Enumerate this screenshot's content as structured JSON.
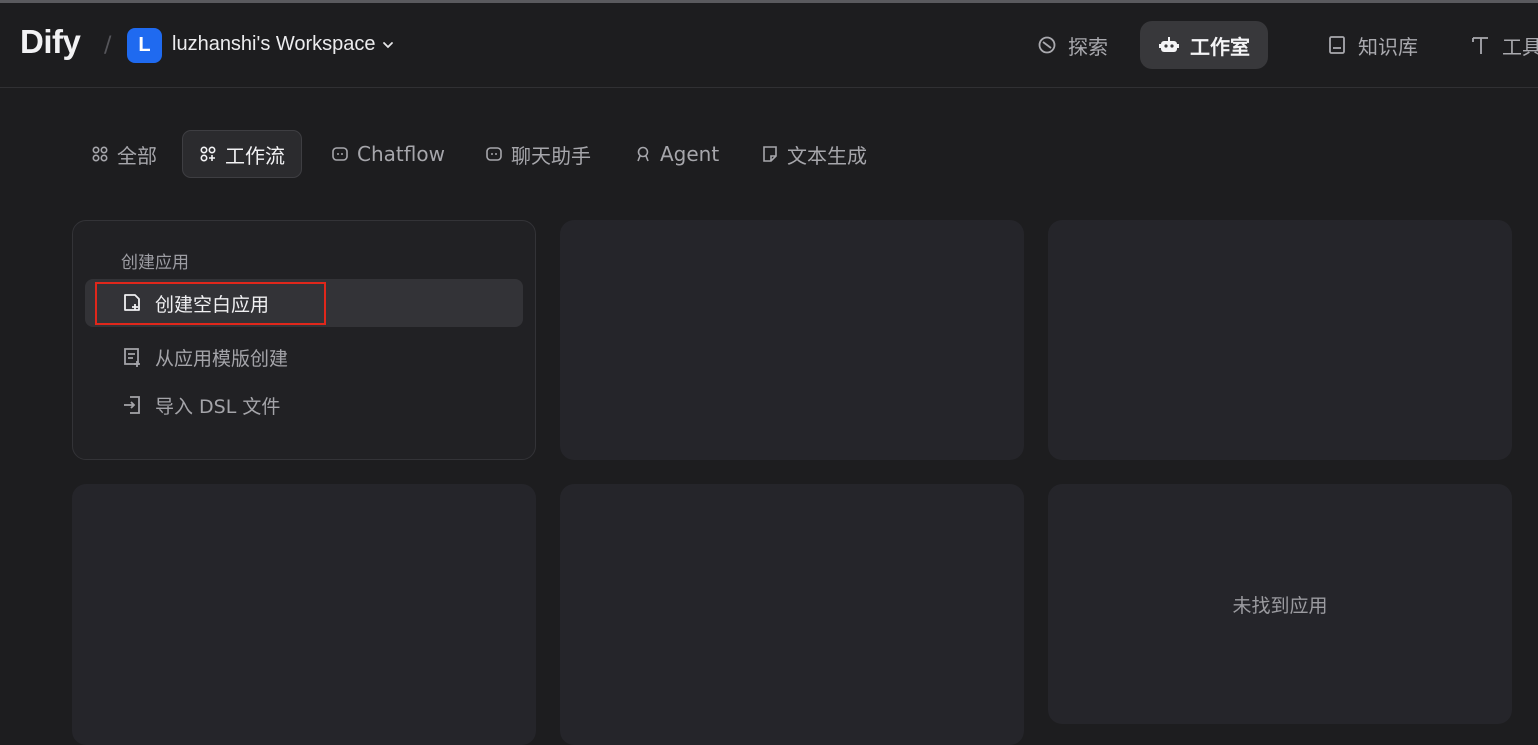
{
  "header": {
    "logo": "Dify",
    "separator": "/",
    "workspace_initial": "L",
    "workspace_name": "luzhanshi's Workspace",
    "nav": [
      {
        "label": "探索",
        "icon": "compass-icon"
      },
      {
        "label": "工作室",
        "icon": "robot-icon",
        "active": true
      },
      {
        "label": "知识库",
        "icon": "book-icon"
      },
      {
        "label": "工具",
        "icon": "hammer-icon"
      }
    ]
  },
  "tabs": [
    {
      "label": "全部",
      "icon": "grid-icon"
    },
    {
      "label": "工作流",
      "icon": "workflow-icon",
      "active": true
    },
    {
      "label": "Chatflow",
      "icon": "chat-bubble-icon"
    },
    {
      "label": "聊天助手",
      "icon": "chat-bubble-icon"
    },
    {
      "label": "Agent",
      "icon": "agent-icon"
    },
    {
      "label": "文本生成",
      "icon": "note-icon"
    }
  ],
  "create_card": {
    "title": "创建应用",
    "items": [
      {
        "label": "创建空白应用",
        "icon": "file-plus-icon",
        "hover": true
      },
      {
        "label": "从应用模版创建",
        "icon": "file-template-icon"
      },
      {
        "label": "导入 DSL 文件",
        "icon": "import-icon"
      }
    ]
  },
  "empty_message": "未找到应用",
  "colors": {
    "background": "#1d1d1f",
    "accent": "#1f6af0",
    "highlight": "#e0271b"
  }
}
